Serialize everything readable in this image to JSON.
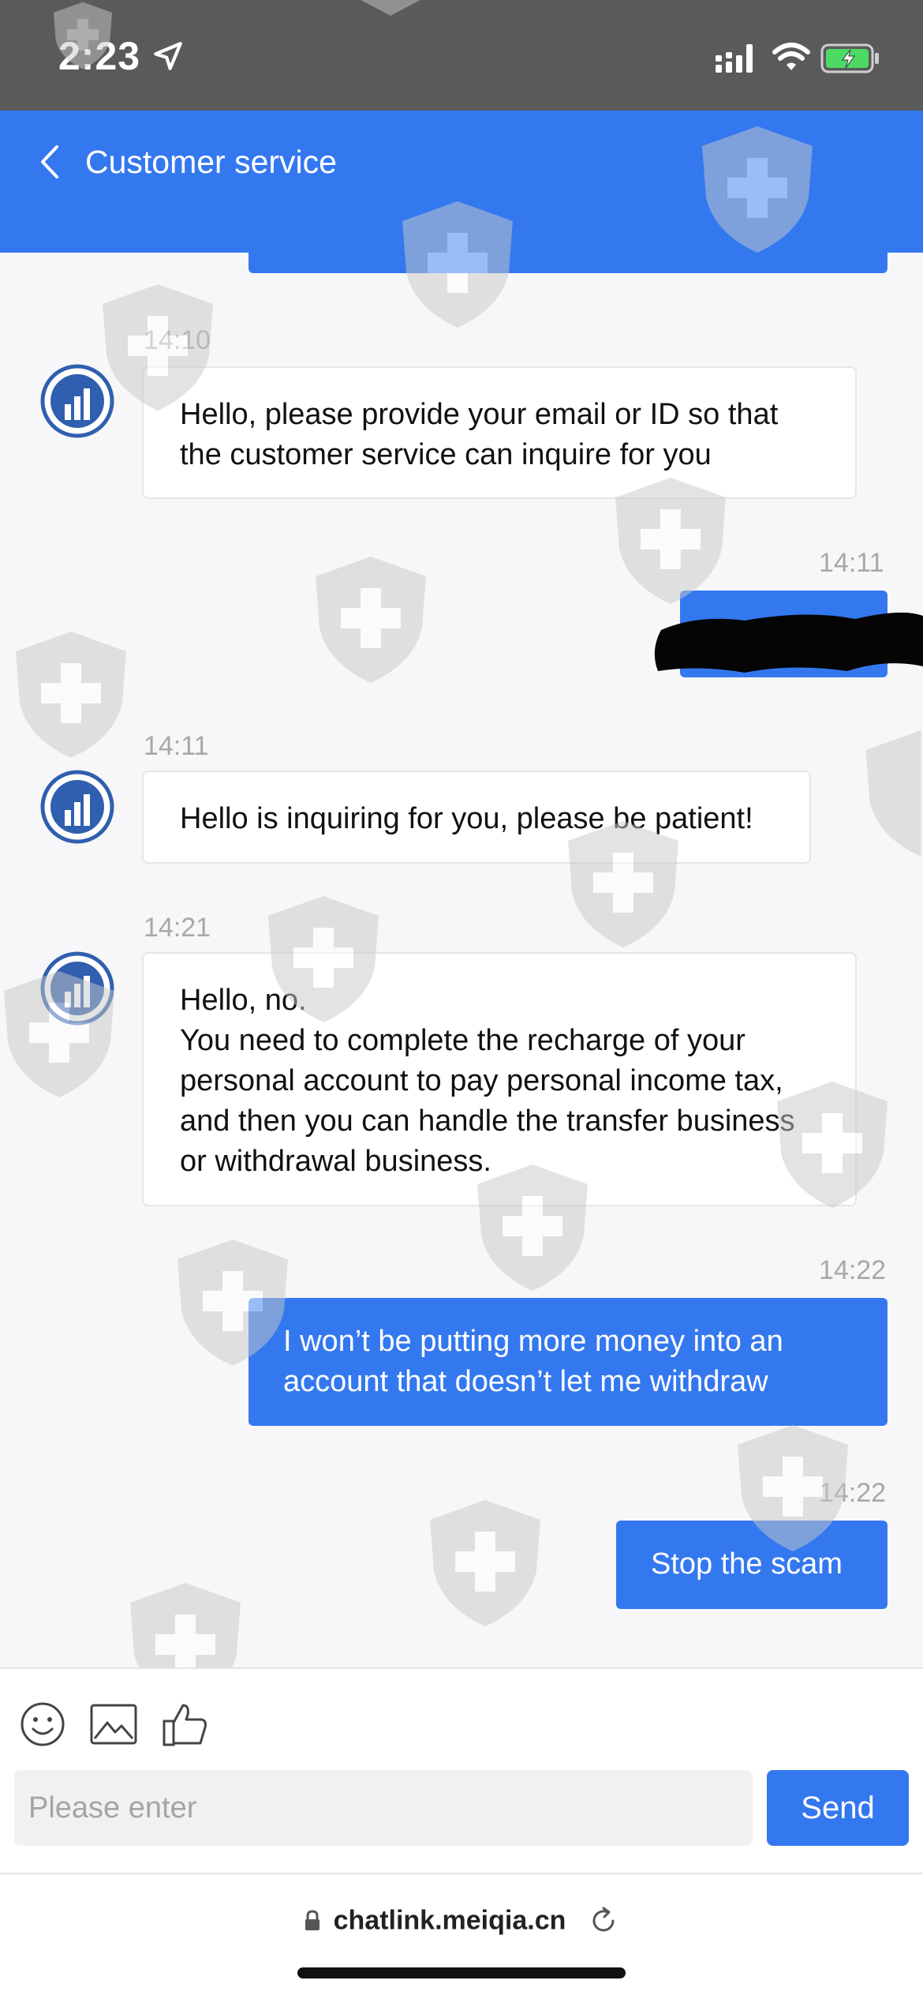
{
  "status_bar": {
    "time": "2:23"
  },
  "header": {
    "title": "Customer service"
  },
  "messages": [
    {
      "time": "14:10",
      "sender": "agent",
      "text": "Hello, please provide your email or ID so that\nthe customer service can inquire for you"
    },
    {
      "time": "14:11",
      "sender": "user",
      "text": "",
      "redacted": true
    },
    {
      "time": "14:11",
      "sender": "agent",
      "text": "Hello is inquiring for you, please be patient!"
    },
    {
      "time": "14:21",
      "sender": "agent",
      "text": "Hello, no.\nYou need to complete the recharge of your\npersonal account to pay personal income tax,\nand then you can handle the transfer business\nor withdrawal business."
    },
    {
      "time": "14:22",
      "sender": "user",
      "text": "I won’t be putting more money into an\naccount that doesn’t let me withdraw"
    },
    {
      "time": "14:22",
      "sender": "user",
      "text": "Stop the scam"
    }
  ],
  "toolbar": {
    "icons": [
      "emoji-icon",
      "image-icon",
      "thumbs-up-icon"
    ]
  },
  "composer": {
    "placeholder": "Please enter",
    "value": "",
    "send_label": "Send"
  },
  "browser": {
    "url": "chatlink.meiqia.cn"
  },
  "colors": {
    "accent": "#3478f0",
    "status_bar": "#5a5a5a",
    "battery": "#4cd964"
  }
}
